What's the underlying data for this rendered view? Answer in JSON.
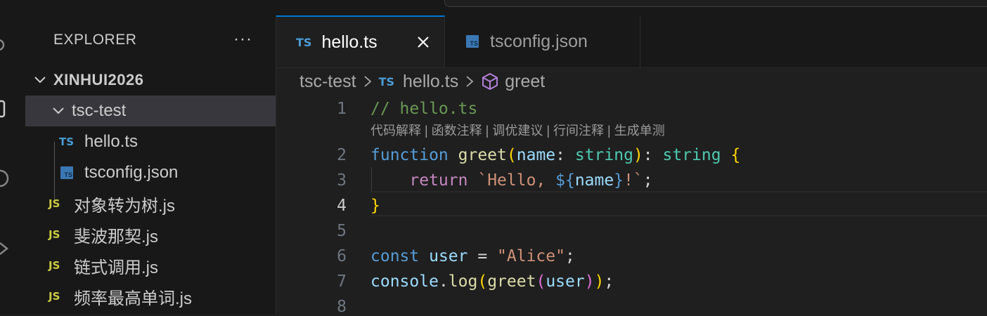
{
  "sidebar": {
    "title": "EXPLORER",
    "more": "···",
    "workspace": "XINHUI2026",
    "folder": "tsc-test",
    "files": [
      {
        "badge": "TS",
        "name": "hello.ts"
      },
      {
        "badge": "TS",
        "name": "tsconfig.json"
      },
      {
        "badge": "JS",
        "name": "对象转为树.js"
      },
      {
        "badge": "JS",
        "name": "斐波那契.js"
      },
      {
        "badge": "JS",
        "name": "链式调用.js"
      },
      {
        "badge": "JS",
        "name": "频率最高单词.js"
      }
    ]
  },
  "tabs": [
    {
      "label": "hello.ts",
      "badge": "TS",
      "active": true
    },
    {
      "label": "tsconfig.json",
      "badge": "TS",
      "active": false
    }
  ],
  "breadcrumb": {
    "folder": "tsc-test",
    "file": "hello.ts",
    "symbol": "greet"
  },
  "editor": {
    "codelens": "代码解释 | 函数注释 | 调优建议 | 行间注释 | 生成单测",
    "active_line": 4,
    "line_numbers": [
      "1",
      "2",
      "3",
      "4",
      "5",
      "6",
      "7",
      "8"
    ],
    "code": {
      "l1_comment": "// hello.ts",
      "l2_function": "function",
      "l2_name": "greet",
      "l2_open": "(",
      "l2_param": "name",
      "l2_colon": ": ",
      "l2_type": "string",
      "l2_close": ")",
      "l2_colon2": ": ",
      "l2_rtype": "string",
      "l2_brace": "{",
      "l3_return": "return",
      "l3_str1": "`Hello, ",
      "l3_interp_open": "${",
      "l3_var": "name",
      "l3_interp_close": "}",
      "l3_str2": "!`",
      "l3_semi": ";",
      "l4_brace": "}",
      "l6_const": "const",
      "l6_var": "user",
      "l6_eq": " = ",
      "l6_str": "\"Alice\"",
      "l6_semi": ";",
      "l7_console": "console",
      "l7_dot": ".",
      "l7_log": "log",
      "l7_p1": "(",
      "l7_greet": "greet",
      "l7_p2": "(",
      "l7_user": "user",
      "l7_p3": ")",
      "l7_p4": ")",
      "l7_semi": ";"
    }
  }
}
